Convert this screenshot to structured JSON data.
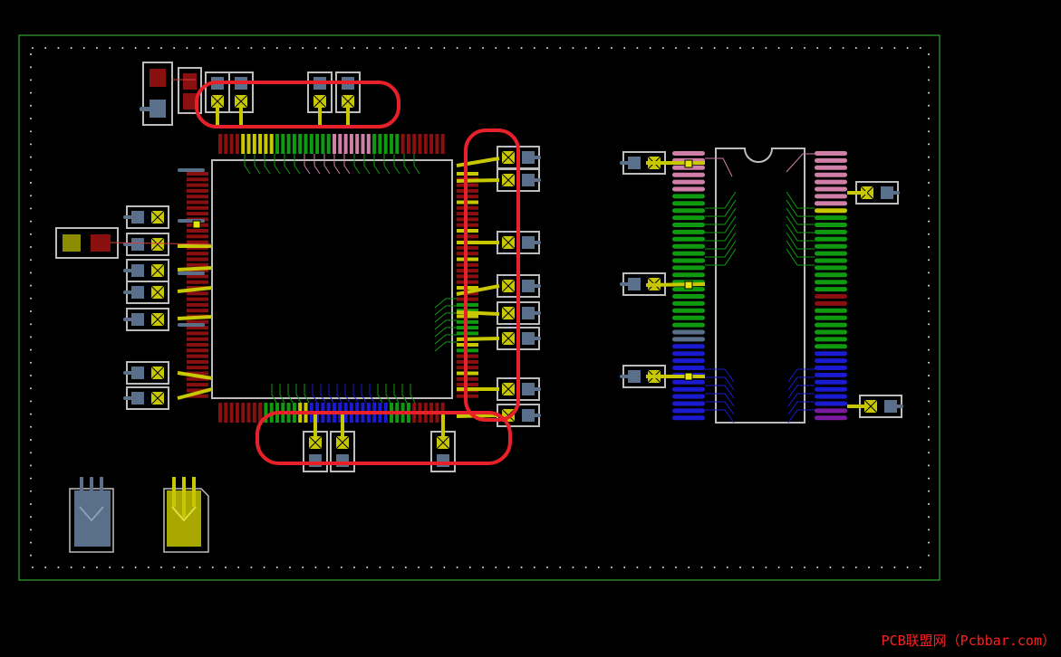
{
  "app": {
    "background": "#000000",
    "board_outline_color": "#3cc63c",
    "keepout_color": "#d8d8d8"
  },
  "colors": {
    "pad_yellow": "#c8c800",
    "pad_yellow_dark": "#8c8c00",
    "pad_blue": "#5a708a",
    "pad_red": "#8a0f0f",
    "trace_green": "#0f9a0f",
    "trace_pink": "#d080a8",
    "trace_blue": "#1a1ad0",
    "trace_purple": "#7a1aa0",
    "silk": "#bdbdbd",
    "highlight": "#e8202a",
    "via_fill": "#e6e600"
  },
  "icons": {
    "qfp_chip": "qfp-ic-footprint",
    "dip_chip": "dip-ic-footprint",
    "smd_cap": "smd-capacitor-footprint",
    "via": "via-marker",
    "to92": "to92-transistor-footprint"
  },
  "watermark": {
    "text": "PCB联盟网（Pcbbar.com）",
    "color": "#ff2020"
  }
}
